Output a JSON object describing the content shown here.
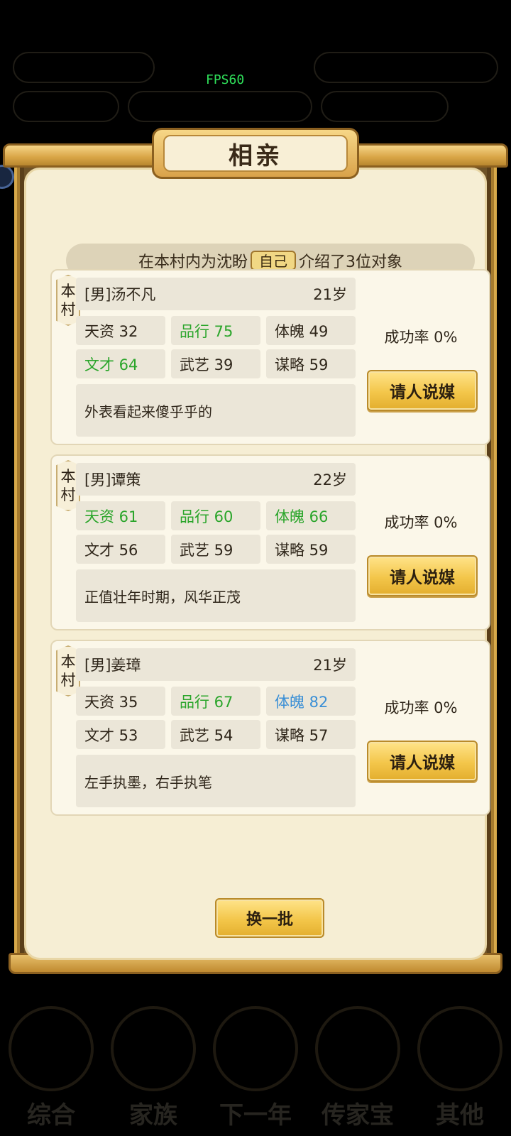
{
  "status": {
    "fps": "FPS60"
  },
  "background": {
    "top_left": "",
    "top_right": "",
    "nav": [
      "综合",
      "家族",
      "下一年",
      "传家宝",
      "其他"
    ]
  },
  "dialog": {
    "title": "相亲",
    "banner": {
      "prefix": "在本村内为沈盼",
      "tag": "自己",
      "suffix": "介绍了3位对象"
    },
    "candidates": [
      {
        "origin": [
          "本",
          "村"
        ],
        "name": "[男]汤不凡",
        "age": "21岁",
        "stats": [
          {
            "label": "天资 32",
            "color": "normal"
          },
          {
            "label": "品行 75",
            "color": "green"
          },
          {
            "label": "体魄 49",
            "color": "normal"
          },
          {
            "label": "文才 64",
            "color": "green"
          },
          {
            "label": "武艺 39",
            "color": "normal"
          },
          {
            "label": "谋略 59",
            "color": "normal"
          }
        ],
        "description": "外表看起来傻乎乎的",
        "success_rate": "成功率 0%",
        "button": "请人说媒"
      },
      {
        "origin": [
          "本",
          "村"
        ],
        "name": "[男]谭策",
        "age": "22岁",
        "stats": [
          {
            "label": "天资 61",
            "color": "green"
          },
          {
            "label": "品行 60",
            "color": "green"
          },
          {
            "label": "体魄 66",
            "color": "green"
          },
          {
            "label": "文才 56",
            "color": "normal"
          },
          {
            "label": "武艺 59",
            "color": "normal"
          },
          {
            "label": "谋略 59",
            "color": "normal"
          }
        ],
        "description": "正值壮年时期，风华正茂",
        "success_rate": "成功率 0%",
        "button": "请人说媒"
      },
      {
        "origin": [
          "本",
          "村"
        ],
        "name": "[男]姜璋",
        "age": "21岁",
        "stats": [
          {
            "label": "天资 35",
            "color": "normal"
          },
          {
            "label": "品行 67",
            "color": "green"
          },
          {
            "label": "体魄 82",
            "color": "blue"
          },
          {
            "label": "文才 53",
            "color": "normal"
          },
          {
            "label": "武艺 54",
            "color": "normal"
          },
          {
            "label": "谋略 57",
            "color": "normal"
          }
        ],
        "description": "左手执墨，右手执笔",
        "success_rate": "成功率 0%",
        "button": "请人说媒"
      }
    ],
    "refresh_button": "换一批"
  },
  "colors": {
    "stat_green": "#2aa52a",
    "stat_blue": "#3a8fd6",
    "gold_button": "#f3c64a",
    "paper": "#f6eed4"
  }
}
